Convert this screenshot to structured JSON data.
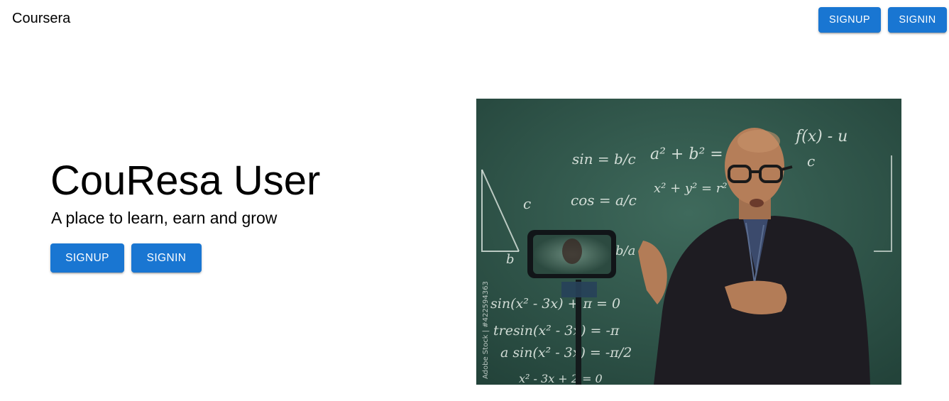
{
  "navbar": {
    "brand": "Coursera",
    "signup_label": "SIGNUP",
    "signin_label": "SIGNIN"
  },
  "hero": {
    "title": "CouResa User",
    "subtitle": "A place to learn, earn and grow",
    "signup_label": "SIGNUP",
    "signin_label": "SIGNIN"
  },
  "image": {
    "watermark": "Adobe Stock | #422594363",
    "board_formulas": [
      "sin = b/c",
      "a² + b² = c²",
      "cos = a/c",
      "x² + y² = r²",
      "f(x) - u",
      "tan = b/a",
      "sin(x² - 3x) + π = 0",
      "tresin(x² - 3x) = -π",
      "a sin(x² - 3x) = -π/2",
      "x² - 3x + 2 = 0",
      "c",
      "b",
      "c"
    ]
  },
  "colors": {
    "primary": "#1976d2",
    "chalkboard": "#2f5147"
  }
}
